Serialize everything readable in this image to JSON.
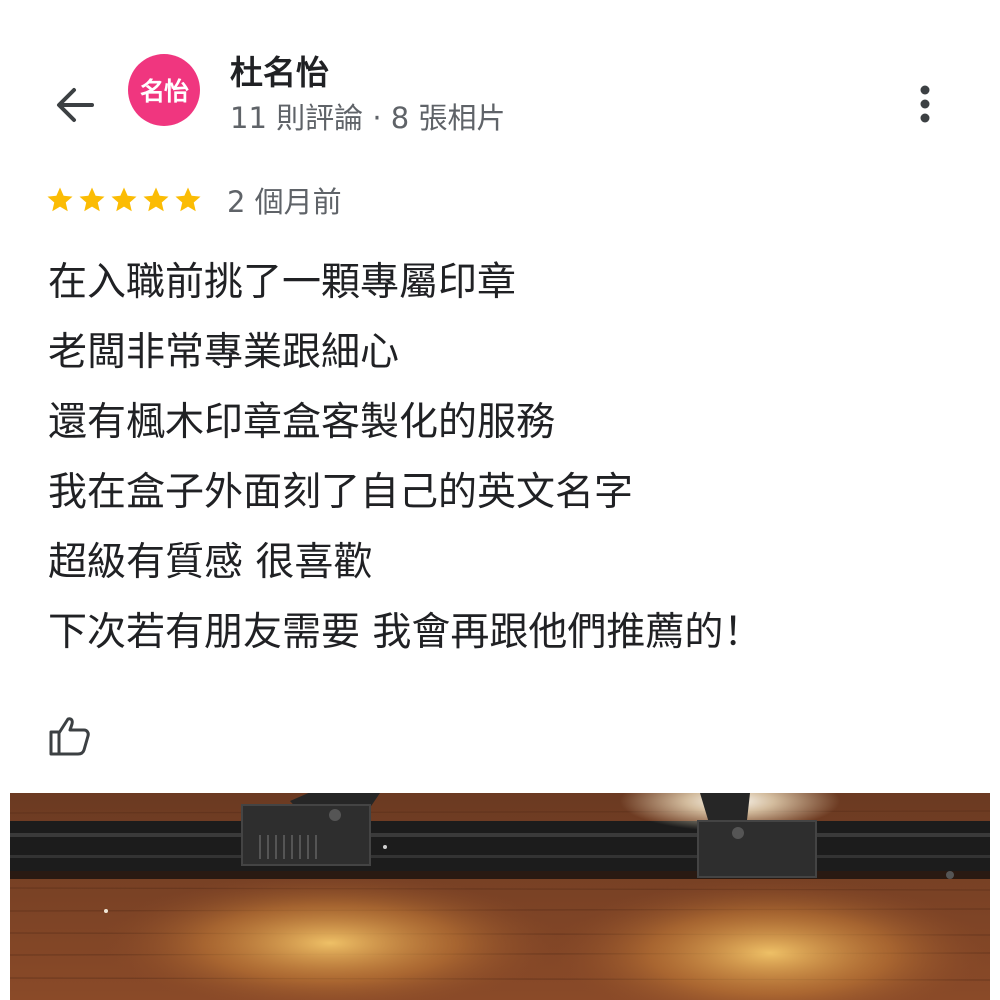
{
  "header": {
    "avatar_text": "名怡",
    "avatar_color": "#f0367f",
    "user_name": "杜名怡",
    "user_meta": "11 則評論 · 8 張相片"
  },
  "review": {
    "stars": 5,
    "star_color": "#fbbc04",
    "date": "2 個月前",
    "lines": [
      "在入職前挑了一顆專屬印章",
      "老闆非常專業跟細心",
      "還有楓木印章盒客製化的服務",
      "我在盒子外面刻了自己的英文名字",
      "超級有質感 很喜歡",
      "下次若有朋友需要 我會再跟他們推薦的！"
    ]
  },
  "icons": {
    "back": "arrow-back-icon",
    "more": "more-vert-icon",
    "like": "thumb-up-icon"
  }
}
